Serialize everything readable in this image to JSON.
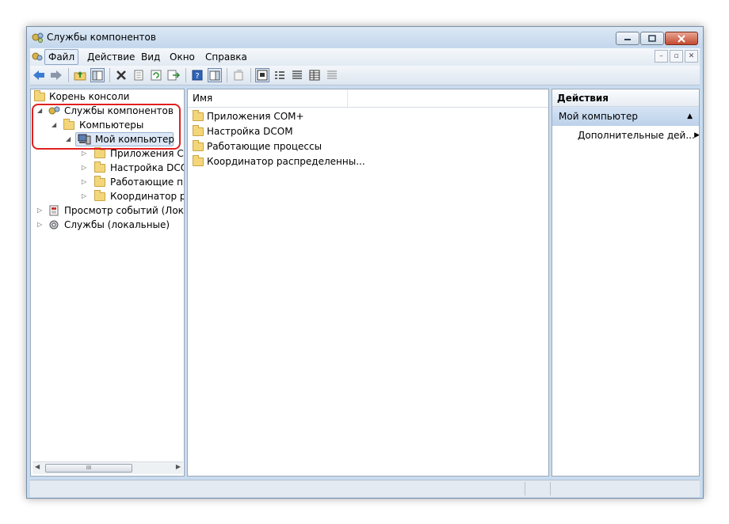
{
  "window": {
    "title": "Службы компонентов",
    "colors": {
      "accent_highlight": "#e02020",
      "frame": "#c9dcef"
    }
  },
  "menu": {
    "items": [
      "Файл",
      "Действие",
      "Вид",
      "Окно",
      "Справка"
    ],
    "active_index": 0
  },
  "toolbar": {
    "buttons": [
      "back-icon",
      "forward-icon",
      "up-folder-icon",
      "show-hide-tree-icon",
      "delete-icon",
      "properties-icon",
      "refresh-icon",
      "export-icon",
      "help-icon",
      "show-hide-action-icon",
      "new-window-icon",
      "large-icons-icon",
      "small-icons-icon",
      "list-view-icon",
      "details-view-icon",
      "properties-view-icon"
    ]
  },
  "tree": {
    "root": "Корень консоли",
    "items": [
      "Службы компонентов",
      "Компьютеры",
      "Мой компьютер",
      "Приложения СО",
      "Настройка DCOM",
      "Работающие прс",
      "Координатор рас",
      "Просмотр событий (Локал",
      "Службы (локальные)"
    ],
    "scroll_thumb_label": "III"
  },
  "list": {
    "column_name": "Имя",
    "items": [
      "Приложения COM+",
      "Настройка DCOM",
      "Работающие процессы",
      "Координатор распределенны..."
    ]
  },
  "actions": {
    "header": "Действия",
    "group": "Мой компьютер",
    "item": "Дополнительные дей..."
  }
}
